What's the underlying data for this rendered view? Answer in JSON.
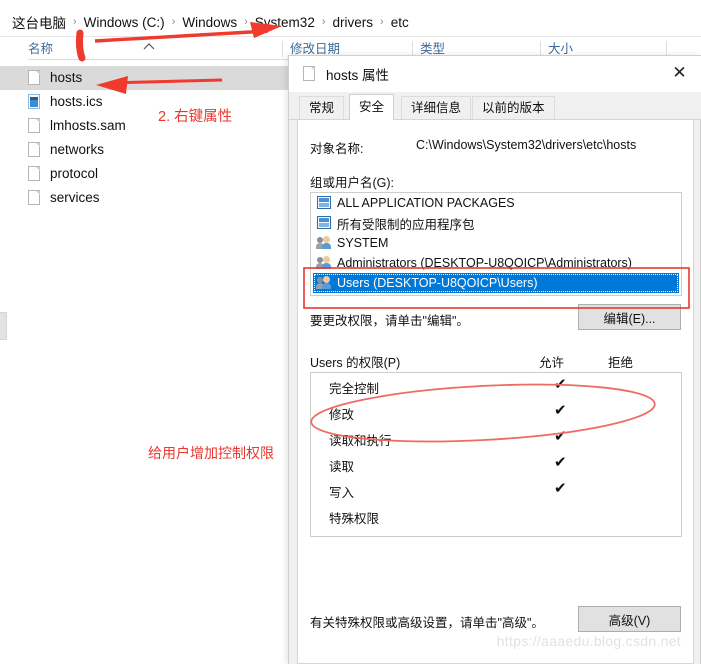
{
  "explorer": {
    "breadcrumb": {
      "items": [
        "这台电脑",
        "Windows (C:)",
        "Windows",
        "System32",
        "drivers",
        "etc"
      ],
      "separator": "›"
    },
    "columns": {
      "name": "名称",
      "date_modified": "修改日期",
      "type": "类型",
      "size": "大小"
    },
    "files": [
      {
        "name": "hosts",
        "icon": "file-icon",
        "selected": true
      },
      {
        "name": "hosts.ics",
        "icon": "calendar-file-icon",
        "selected": false
      },
      {
        "name": "lmhosts.sam",
        "icon": "file-icon",
        "selected": false
      },
      {
        "name": "networks",
        "icon": "file-icon",
        "selected": false
      },
      {
        "name": "protocol",
        "icon": "file-icon",
        "selected": false
      },
      {
        "name": "services",
        "icon": "file-icon",
        "selected": false
      }
    ]
  },
  "dialog": {
    "title": "hosts 属性",
    "title_icon": "file-icon",
    "close_label": "✕",
    "tabs": [
      {
        "label": "常规",
        "active": false
      },
      {
        "label": "安全",
        "active": true
      },
      {
        "label": "详细信息",
        "active": false
      },
      {
        "label": "以前的版本",
        "active": false
      }
    ],
    "object_name_label": "对象名称:",
    "object_name_value": "C:\\Windows\\System32\\drivers\\etc\\hosts",
    "groups_label": "组或用户名(G):",
    "groups": [
      {
        "name": "ALL APPLICATION PACKAGES",
        "icon": "package-icon",
        "selected": false
      },
      {
        "name": "所有受限制的应用程序包",
        "icon": "package-icon",
        "selected": false
      },
      {
        "name": "SYSTEM",
        "icon": "users-icon",
        "selected": false
      },
      {
        "name": "Administrators (DESKTOP-U8QOICP\\Administrators)",
        "icon": "users-icon",
        "selected": false
      },
      {
        "name": "Users (DESKTOP-U8QOICP\\Users)",
        "icon": "users-icon",
        "selected": true
      }
    ],
    "edit_hint": "要更改权限，请单击\"编辑\"。",
    "edit_button": "编辑(E)...",
    "permissions_label": "Users 的权限(P)",
    "allow_header": "允许",
    "deny_header": "拒绝",
    "permissions": [
      {
        "name": "完全控制",
        "allow": "✔",
        "deny": ""
      },
      {
        "name": "修改",
        "allow": "✔",
        "deny": ""
      },
      {
        "name": "读取和执行",
        "allow": "✔",
        "deny": ""
      },
      {
        "name": "读取",
        "allow": "✔",
        "deny": ""
      },
      {
        "name": "写入",
        "allow": "✔",
        "deny": ""
      },
      {
        "name": "特殊权限",
        "allow": "",
        "deny": ""
      }
    ],
    "advanced_hint": "有关特殊权限或高级设置，请单击\"高级\"。",
    "advanced_button": "高级(V)",
    "watermark": "https://aaaedu.blog.csdn.net"
  },
  "annotations": {
    "step2": "2. 右键属性",
    "give_permission": "给用户增加控制权限",
    "color": "#e8382f"
  }
}
